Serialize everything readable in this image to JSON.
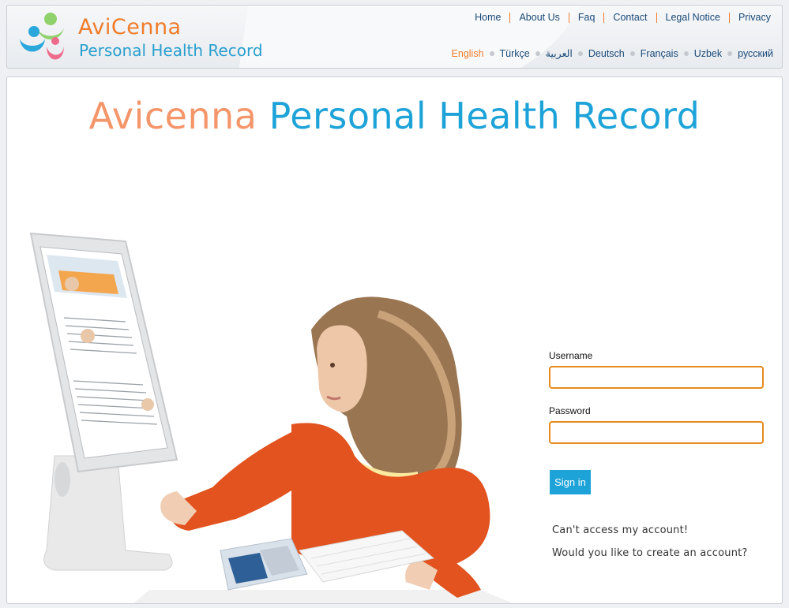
{
  "brand": {
    "name": "AviCenna",
    "subtitle": "Personal Health Record"
  },
  "nav": {
    "items": [
      "Home",
      "About Us",
      "Faq",
      "Contact",
      "Legal Notice",
      "Privacy"
    ]
  },
  "languages": {
    "items": [
      "English",
      "Türkçe",
      "العربية",
      "Deutsch",
      "Français",
      "Uzbek",
      "русский"
    ],
    "active": "English"
  },
  "main": {
    "title_part1": "Avicenna",
    "title_part2": "Personal Health Record"
  },
  "login": {
    "username_label": "Username",
    "username_value": "",
    "password_label": "Password",
    "password_value": "",
    "signin_label": "Sign in",
    "cant_access": "Can't access my account!",
    "create_account": "Would you like to create an account?"
  },
  "colors": {
    "brand_orange": "#f07c2a",
    "brand_blue": "#1ea3d8",
    "title_orange": "#f4956a",
    "input_border": "#e98a1e",
    "nav_text": "#1b4a78"
  },
  "icons": {
    "logo": "family-people-logo"
  }
}
